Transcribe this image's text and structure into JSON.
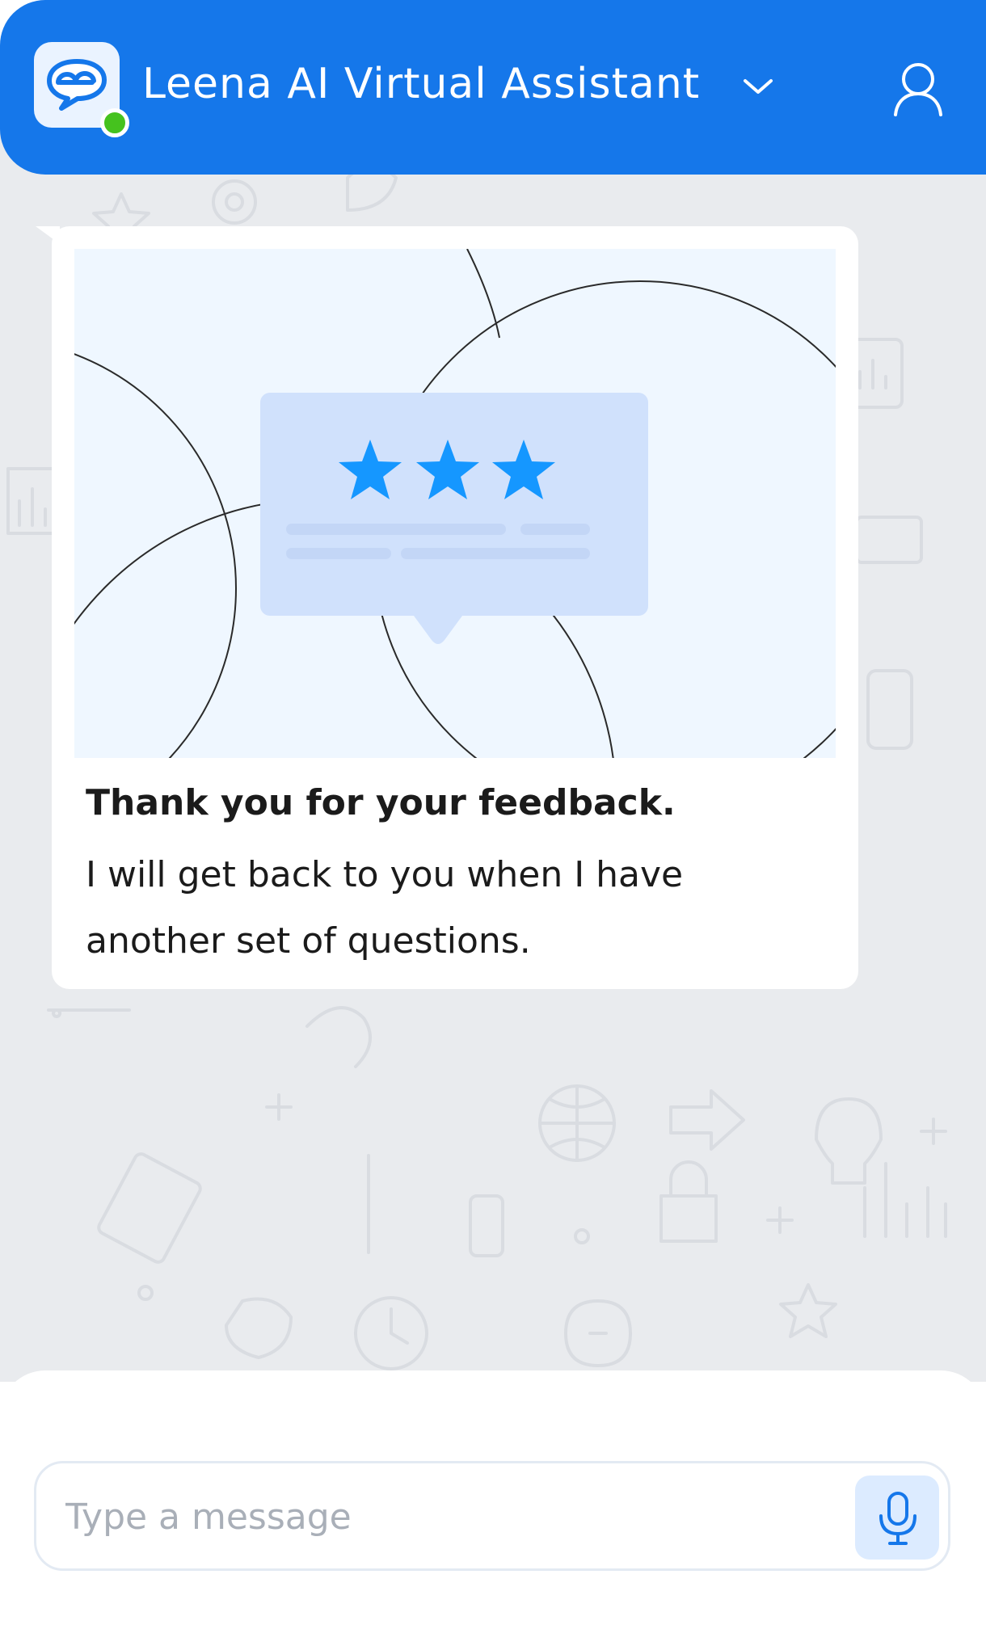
{
  "header": {
    "title": "Leena AI Virtual Assistant",
    "logo_icon": "chat-bubble-logo-icon",
    "status": "online",
    "dropdown_icon": "chevron-down-icon",
    "profile_icon": "user-icon"
  },
  "message": {
    "illustration": {
      "icon": "rating-speech-bubble",
      "stars": 3
    },
    "heading": "Thank you for your feedback.",
    "body": "I will get back to you when I have another set of questions."
  },
  "composer": {
    "placeholder": "Type a message",
    "mic_icon": "microphone-icon"
  },
  "colors": {
    "header_bg": "#1577ea",
    "chat_bg": "#e9ebee",
    "online": "#45c21e",
    "star": "#1597ff",
    "mic_bg": "#dcebff"
  }
}
